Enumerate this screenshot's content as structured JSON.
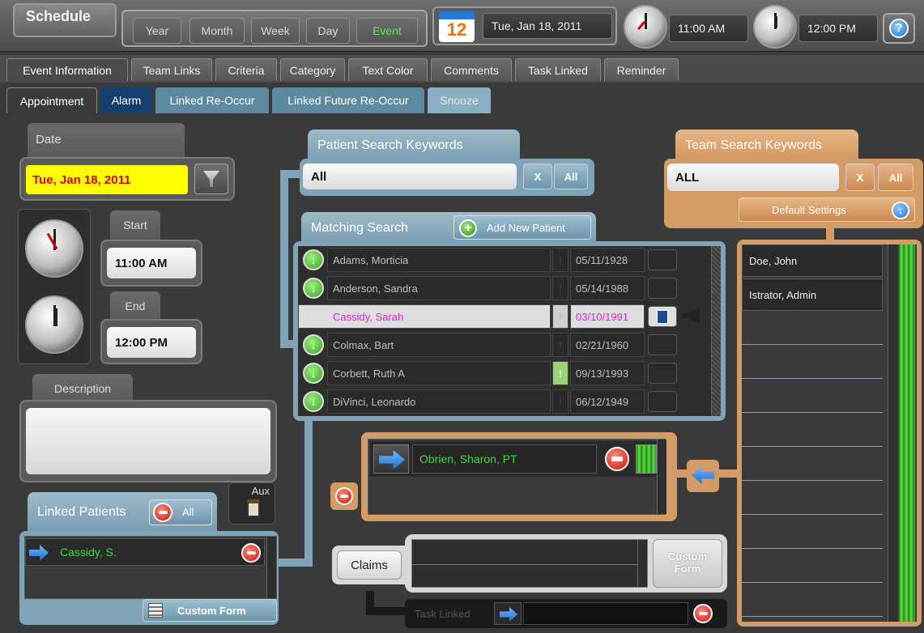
{
  "header": {
    "title": "Schedule",
    "views": [
      "Year",
      "Month",
      "Week",
      "Day",
      "Event"
    ],
    "calendar_day": "12",
    "date": "Tue, Jan 18, 2011",
    "start_time": "11:00 AM",
    "end_time": "12:00 PM",
    "help_icon": "?"
  },
  "tabs": [
    "Event Information",
    "Team Links",
    "Criteria",
    "Category",
    "Text Color",
    "Comments",
    "Task Linked",
    "Reminder"
  ],
  "subtabs": [
    "Appointment",
    "Alarm",
    "Linked Re-Occur",
    "Linked Future Re-Occur",
    "Snooze"
  ],
  "date_panel": {
    "label": "Date",
    "value": "Tue, Jan 18, 2011",
    "start_label": "Start",
    "start_value": "11:00 AM",
    "end_label": "End",
    "end_value": "12:00 PM",
    "description_label": "Description"
  },
  "aux": {
    "label": "Aux"
  },
  "linked_patients": {
    "label": "Linked Patients",
    "all_label": "All",
    "item": "Cassidy, S.",
    "custom_form": "Custom Form"
  },
  "patient_search": {
    "label": "Patient Search Keywords",
    "value": "All",
    "clear_label": "X",
    "all_label": "All",
    "matching_label": "Matching Search",
    "add_new_label": "Add New Patient",
    "alert_glyph": "!",
    "rows": [
      {
        "name": "Adams, Morticia",
        "dob": "05/11/1928",
        "selected": false,
        "flag": false
      },
      {
        "name": "Anderson, Sandra",
        "dob": "05/14/1988",
        "selected": false,
        "flag": false
      },
      {
        "name": "Cassidy, Sarah",
        "dob": "03/10/1991",
        "selected": true,
        "flag": false
      },
      {
        "name": "Colmax, Bart",
        "dob": "02/21/1960",
        "selected": false,
        "flag": false
      },
      {
        "name": "Corbett, Ruth A",
        "dob": "09/13/1993",
        "selected": false,
        "flag": true
      },
      {
        "name": "DiVinci, Leonardo",
        "dob": "06/12/1949",
        "selected": false,
        "flag": false
      }
    ]
  },
  "linked_team": {
    "item": "Obrien, Sharon, PT"
  },
  "claims": {
    "label": "Claims",
    "custom_form": "Custom\nForm"
  },
  "task_linked": {
    "label": "Task Linked"
  },
  "team_search": {
    "label": "Team Search Keywords",
    "value": "ALL",
    "clear_label": "X",
    "all_label": "All",
    "default_settings": "Default Settings",
    "members": [
      "Doe, John",
      "Istrator, Admin"
    ]
  },
  "colors": {
    "blue_frame": "#7fa3b7",
    "orange_frame": "#d39b66",
    "highlight_date_bg": "#ffff00",
    "highlight_date_text": "#d40000",
    "green_text": "#3ddc3a",
    "magenta_text": "#e020e0"
  },
  "icons": [
    "calendar-icon",
    "clock-icon",
    "help-icon",
    "filter-icon",
    "green-down-arrow-icon",
    "blue-right-arrow-icon",
    "red-minus-icon",
    "add-icon",
    "document-icon",
    "megaphone-icon",
    "clipboard-icon",
    "list-icon"
  ]
}
